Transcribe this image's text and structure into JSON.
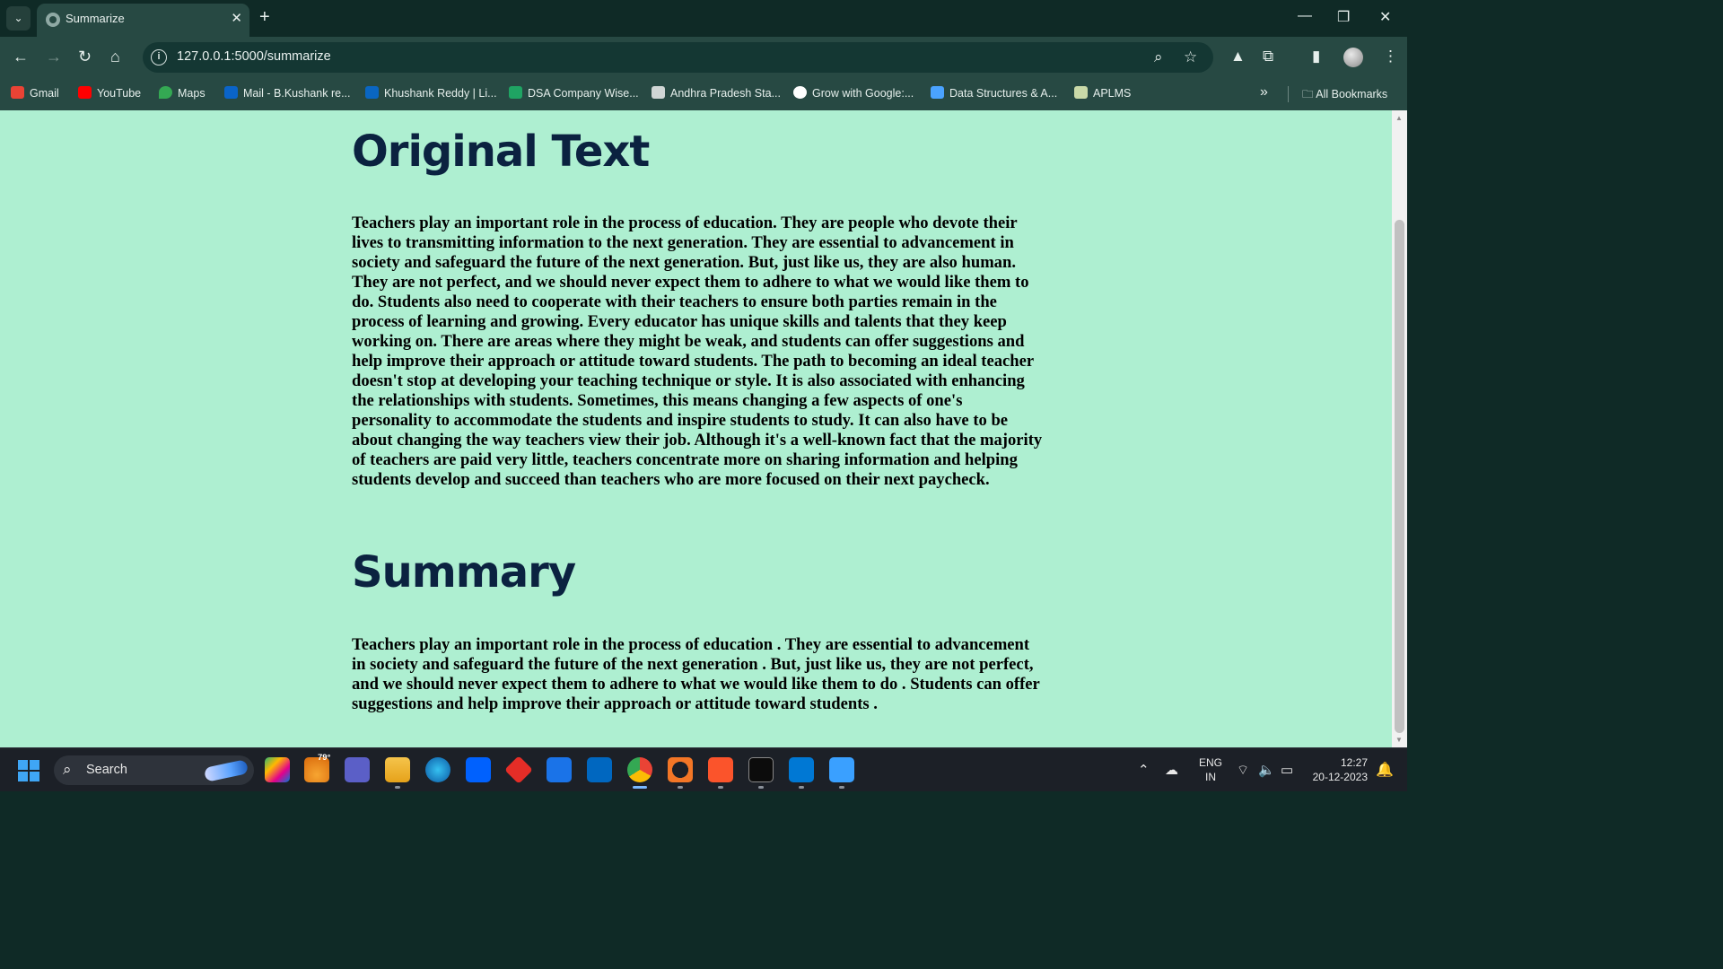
{
  "browser": {
    "tab_title": "Summarize",
    "tab_close": "✕",
    "new_tab": "+",
    "url": "127.0.0.1:5000/summarize",
    "bookmarks": [
      {
        "label": "Gmail",
        "icon": "gmail-icon",
        "color": "#ea4335"
      },
      {
        "label": "YouTube",
        "icon": "youtube-icon",
        "color": "#ff0000"
      },
      {
        "label": "Maps",
        "icon": "maps-icon",
        "color": "#34a853"
      },
      {
        "label": "Mail - B.Kushank re...",
        "icon": "outlook-icon",
        "color": "#0a64c8"
      },
      {
        "label": "Khushank Reddy | Li...",
        "icon": "linkedin-icon",
        "color": "#0a66c2"
      },
      {
        "label": "DSA Company Wise...",
        "icon": "sheets-icon",
        "color": "#1fa463"
      },
      {
        "label": "Andhra Pradesh Sta...",
        "icon": "chart-icon",
        "color": "#d0d6d5"
      },
      {
        "label": "Grow with Google:...",
        "icon": "google-icon",
        "color": "#ffffff"
      },
      {
        "label": "Data Structures & A...",
        "icon": "udemy-icon",
        "color": "#4aa3ff"
      },
      {
        "label": "APLMS",
        "icon": "aplms-icon",
        "color": "#c9d9a8"
      }
    ],
    "more_bookmarks": "»",
    "all_bookmarks": "All Bookmarks"
  },
  "page": {
    "original_heading": "Original Text",
    "original_text": "Teachers play an important role in the process of education. They are people who devote their lives to transmitting information to the next generation. They are essential to advancement in society and safeguard the future of the next generation. But, just like us, they are also human. They are not perfect, and we should never expect them to adhere to what we would like them to do. Students also need to cooperate with their teachers to ensure both parties remain in the process of learning and growing. Every educator has unique skills and talents that they keep working on. There are areas where they might be weak, and students can offer suggestions and help improve their approach or attitude toward students. The path to becoming an ideal teacher doesn't stop at developing your teaching technique or style. It is also associated with enhancing the relationships with students. Sometimes, this means changing a few aspects of one's personality to accommodate the students and inspire students to study. It can also have to be about changing the way teachers view their job. Although it's a well-known fact that the majority of teachers are paid very little, teachers concentrate more on sharing information and helping students develop and succeed than teachers who are more focused on their next paycheck.",
    "summary_heading": "Summary",
    "summary_text": "Teachers play an important role in the process of education . They are essential to advancement in society and safeguard the future of the next generation . But, just like us, they are not perfect, and we should never expect them to adhere to what we would like them to do . Students can offer suggestions and help improve their approach or attitude toward students ."
  },
  "taskbar": {
    "search_label": "Search",
    "weather_temp": "79°",
    "language_line1": "ENG",
    "language_line2": "IN",
    "time": "12:27",
    "date": "20-12-2023"
  },
  "colors": {
    "page_background": "#aeefd1",
    "heading": "#0b2240",
    "browser_chrome": "#274943"
  }
}
